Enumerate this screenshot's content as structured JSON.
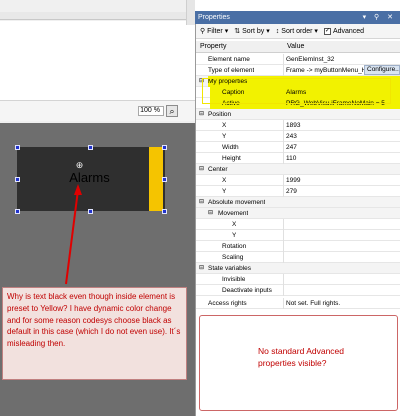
{
  "panel": {
    "title": "Properties",
    "title_controls": "▾ ⚲ ✕"
  },
  "toolbar": {
    "filter": "Filter",
    "sort_by": "Sort by",
    "sort_order": "Sort order",
    "advanced": "Advanced",
    "advanced_checked": true
  },
  "grid_header": {
    "property": "Property",
    "value": "Value"
  },
  "rows": {
    "element_name": {
      "name": "Element name",
      "value": "GenElemInst_32"
    },
    "type_of_element": {
      "name": "Type of element",
      "value": "Frame -> myButtonMenu_H"
    },
    "my_properties": {
      "name": "My properties",
      "toggle": "⊟"
    },
    "caption": {
      "name": "Caption",
      "value": "Alarms"
    },
    "active": {
      "name": "Active",
      "value": "PRG_WebVisu.iFrameNoMain = 5"
    },
    "position": {
      "name": "Position",
      "toggle": "⊟"
    },
    "x": {
      "name": "X",
      "value": "1893"
    },
    "y": {
      "name": "Y",
      "value": "243"
    },
    "width": {
      "name": "Width",
      "value": "247"
    },
    "height": {
      "name": "Height",
      "value": "110"
    },
    "center": {
      "name": "Center",
      "toggle": "⊟"
    },
    "cx": {
      "name": "X",
      "value": "1999"
    },
    "cy": {
      "name": "Y",
      "value": "279"
    },
    "absolute_movement": {
      "name": "Absolute movement",
      "toggle": "⊟"
    },
    "movement": {
      "name": "Movement",
      "toggle": "⊟"
    },
    "mx": {
      "name": "X",
      "value": ""
    },
    "my": {
      "name": "Y",
      "value": ""
    },
    "rotation": {
      "name": "Rotation",
      "value": ""
    },
    "scaling": {
      "name": "Scaling",
      "value": ""
    },
    "state_variables": {
      "name": "State variables",
      "toggle": "⊟"
    },
    "invisible": {
      "name": "Invisible",
      "value": ""
    },
    "deactivate_inputs": {
      "name": "Deactivate inputs",
      "value": ""
    },
    "access_rights": {
      "name": "Access rights",
      "value": "Not set. Full rights."
    }
  },
  "configure_button": "Configure...",
  "editor": {
    "zoom": "100 %",
    "zoom_icon": "magnifier-icon",
    "element_caption": "Alarms",
    "element_bg_color": "#2f2f2f",
    "element_bar_color": "#f5c400"
  },
  "annotations": {
    "left_note": "Why is text black even though inside element is preset to Yellow? I have dynamic color change and for some reason codesys choose black as default in this case (which I do not even use). It´s misleading then.",
    "right_note": "No standard Advanced properties visible?",
    "note_color": "#c00000",
    "highlight_color": "#f2f200"
  }
}
